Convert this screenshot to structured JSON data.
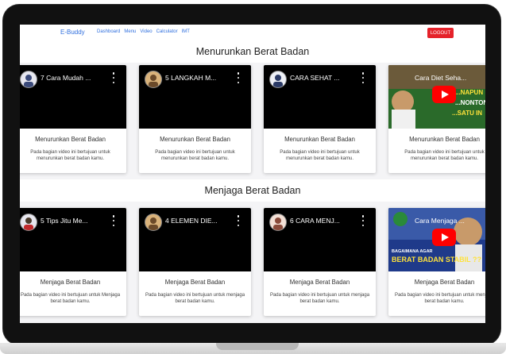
{
  "navbar": {
    "brand": "E-Buddy",
    "links": [
      "Dashboard",
      "Menu",
      "Video",
      "Calculator",
      "IMT"
    ],
    "logout_label": "LOGOUT"
  },
  "sections": [
    {
      "title": "Menurunkan Berat Badan",
      "cards": [
        {
          "video_title": "7 Cara Mudah ...",
          "card_title": "Menurunkan Berat Badan",
          "description": "Pada bagian video ini bertujuan untuk menurunkan berat badan kamu."
        },
        {
          "video_title": "5 LANGKAH M...",
          "card_title": "Menurunkan Berat Badan",
          "description": "Pada bagian video ini bertujuan untuk menurunkan berat badan kamu."
        },
        {
          "video_title": "CARA SEHAT ...",
          "card_title": "Menurunkan Berat Badan",
          "description": "Pada bagian video ini bertujuan untuk menurunkan berat badan kamu."
        },
        {
          "video_title": "Cara Diet Seha...",
          "card_title": "Menurunkan Berat Badan",
          "description": "Pada bagian video ini bertujuan untuk menurunkan berat badan kamu."
        }
      ]
    },
    {
      "title": "Menjaga Berat Badan",
      "cards": [
        {
          "video_title": "5 Tips Jitu Me...",
          "card_title": "Menjaga Berat Badan",
          "description": "Pada bagian video ini bertujuan untuk Menjaga berat badan kamu."
        },
        {
          "video_title": "4 ELEMEN DIE...",
          "card_title": "Menjaga Berat Badan",
          "description": "Pada bagian video ini bertujuan untuk menjaga berat badan kamu."
        },
        {
          "video_title": "6 CARA MENJ...",
          "card_title": "Menjaga Berat Badan",
          "description": "Pada bagian video ini bertujuan untuk menjaga berat badan kamu."
        },
        {
          "video_title": "Cara Menjaga ...",
          "card_title": "Menjaga Berat Badan",
          "description": "Pada bagian video ini bertujuan untuk menjaga berat badan kamu."
        }
      ]
    }
  ],
  "thumbnails": {
    "card4_overlay": [
      "...NAPUN",
      "...NONTON",
      "...SATU IN"
    ],
    "card8_overlay": [
      "BAGAIMANA AGAR",
      "BERAT BADAN STABIL ??"
    ]
  },
  "colors": {
    "brand": "#2f6fde",
    "logout": "#e5222a",
    "play": "#ff0000"
  }
}
